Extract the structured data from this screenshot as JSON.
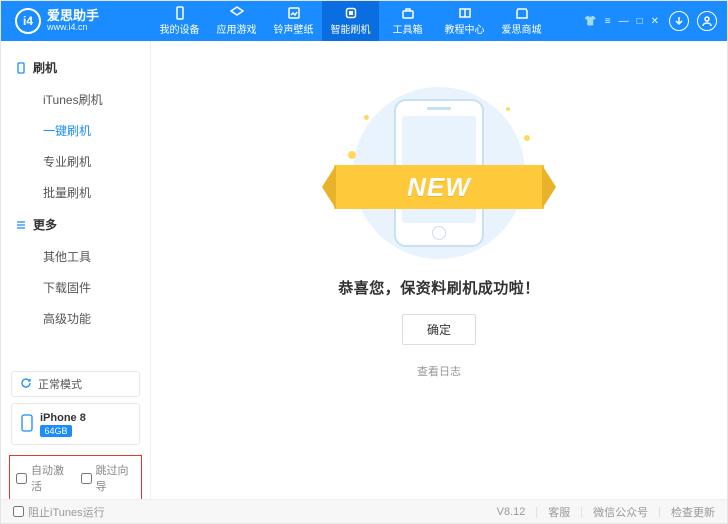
{
  "brand": {
    "cn": "爱思助手",
    "en": "www.i4.cn",
    "logo": "i4"
  },
  "tabs": [
    {
      "label": "我的设备"
    },
    {
      "label": "应用游戏"
    },
    {
      "label": "铃声壁纸"
    },
    {
      "label": "智能刷机"
    },
    {
      "label": "工具箱"
    },
    {
      "label": "教程中心"
    },
    {
      "label": "爱思商城"
    }
  ],
  "sidebar": {
    "group1": "刷机",
    "items1": [
      "iTunes刷机",
      "一键刷机",
      "专业刷机",
      "批量刷机"
    ],
    "group2": "更多",
    "items2": [
      "其他工具",
      "下载固件",
      "高级功能"
    ],
    "status": "正常模式",
    "device": {
      "name": "iPhone 8",
      "storage": "64GB"
    },
    "check1": "自动激活",
    "check2": "跳过向导"
  },
  "main": {
    "ribbon": "NEW",
    "success": "恭喜您，保资料刷机成功啦！",
    "ok": "确定",
    "log": "查看日志"
  },
  "footer": {
    "block_itunes": "阻止iTunes运行",
    "version": "V8.12",
    "service": "客服",
    "wechat": "微信公众号",
    "update": "检查更新"
  }
}
